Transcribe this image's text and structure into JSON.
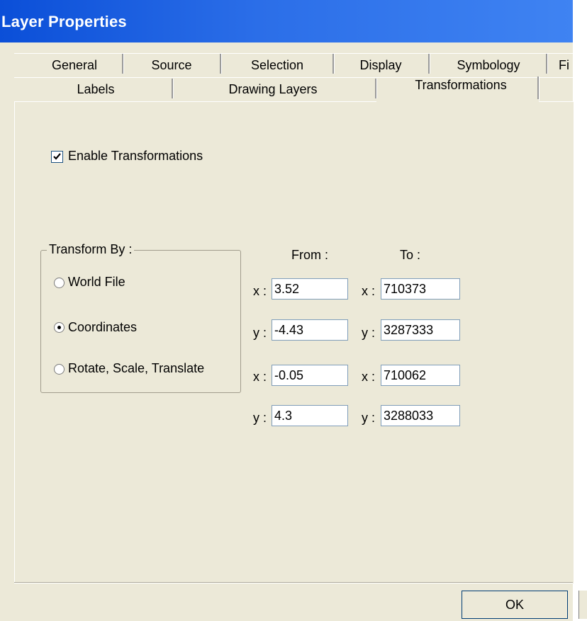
{
  "window": {
    "title": "Layer Properties"
  },
  "tabs": {
    "row1": [
      "General",
      "Source",
      "Selection",
      "Display",
      "Symbology",
      "Fi"
    ],
    "row2": [
      "Labels",
      "Drawing Layers",
      "Transformations"
    ],
    "active": "Transformations"
  },
  "enable_transformations": {
    "label": "Enable Transformations",
    "checked": true
  },
  "transform_by": {
    "title": "Transform By :",
    "options": [
      "World File",
      "Coordinates",
      "Rotate, Scale, Translate"
    ],
    "selected": "Coordinates"
  },
  "coords": {
    "from_header": "From :",
    "to_header": "To :",
    "rows": [
      {
        "axis": "x :",
        "from": "3.52",
        "to": "710373"
      },
      {
        "axis": "y :",
        "from": "-4.43",
        "to": "3287333"
      },
      {
        "axis": "x :",
        "from": "-0.05",
        "to": "710062"
      },
      {
        "axis": "y :",
        "from": "4.3",
        "to": "3288033"
      }
    ]
  },
  "buttons": {
    "ok": "OK"
  }
}
